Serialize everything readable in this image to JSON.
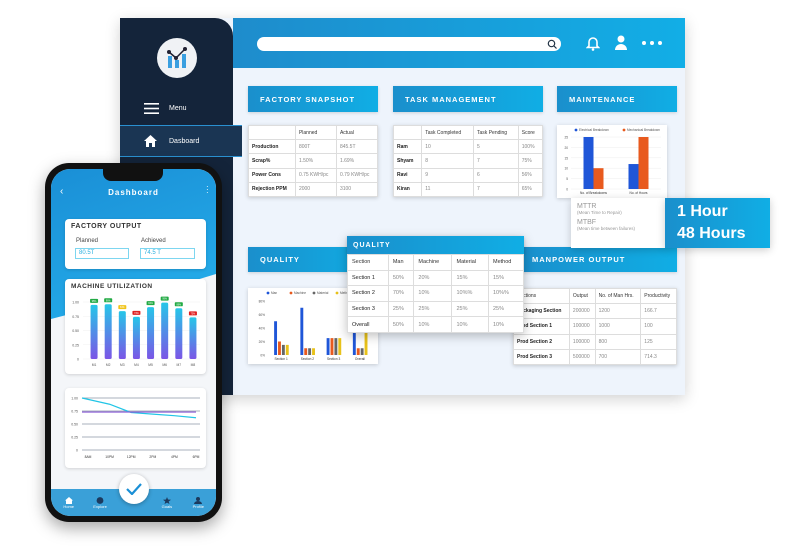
{
  "sidebar": {
    "menu_label": "Menu",
    "dashboard_label": "Dasboard"
  },
  "factory_snapshot": {
    "title": "FACTORY SNAPSHOT",
    "headers": [
      "",
      "Planned",
      "Actual"
    ],
    "rows": [
      [
        "Production",
        "800T",
        "845.5T"
      ],
      [
        "Scrap%",
        "1.50%",
        "1.69%"
      ],
      [
        "Power Cons",
        "0.75 KWH/pc",
        "0.79 KWH/pc"
      ],
      [
        "Rejection PPM",
        "2000",
        "3100"
      ]
    ]
  },
  "task_management": {
    "title": "TASK MANAGEMENT",
    "headers": [
      "",
      "Task Completed",
      "Task Pending",
      "Score"
    ],
    "rows": [
      [
        "Ram",
        "10",
        "5",
        "100%"
      ],
      [
        "Shyam",
        "8",
        "7",
        "75%"
      ],
      [
        "Ravi",
        "9",
        "6",
        "56%"
      ],
      [
        "Kiran",
        "11",
        "7",
        "65%"
      ]
    ]
  },
  "maintenance": {
    "title": "MAINTENANCE",
    "mttr_label": "MTTR",
    "mttr_desc": "(Mean Time to Repair)",
    "mttr_value": "1 Hour",
    "mtbf_label": "MTBF",
    "mtbf_desc": "(Mean time between failures)",
    "mtbf_value": "48 Hours"
  },
  "quality": {
    "title": "QUALITY",
    "popup_title": "QUALITY",
    "headers": [
      "Section",
      "Man",
      "Machine",
      "Material",
      "Method"
    ],
    "rows": [
      [
        "Section 1",
        "50%",
        "20%",
        "15%",
        "15%"
      ],
      [
        "Section 2",
        "70%",
        "10%",
        "10%%",
        "10%%"
      ],
      [
        "Section 3",
        "25%",
        "25%",
        "25%",
        "25%"
      ],
      [
        "Overall",
        "50%",
        "10%",
        "10%",
        "10%"
      ]
    ]
  },
  "manpower": {
    "title": "MANPOWER OUTPUT",
    "headers": [
      "Sections",
      "Output",
      "No. of Man Hrs.",
      "Productivity"
    ],
    "rows": [
      [
        "Packaging Section",
        "200000",
        "1200",
        "166.7"
      ],
      [
        "Prod Section 1",
        "100000",
        "1000",
        "100"
      ],
      [
        "Prod Section 2",
        "100000",
        "800",
        "125"
      ],
      [
        "Prod Section 3",
        "500000",
        "700",
        "714.3"
      ]
    ]
  },
  "phone": {
    "title": "Dashboard",
    "factory_output_title": "FACTORY OUTPUT",
    "planned_label": "Planned",
    "planned_value": "80.5T",
    "achieved_label": "Achieved",
    "achieved_value": "74.5 T",
    "machine_util_title": "MACHINE UTILIZATION",
    "nav": [
      "Home",
      "Explore",
      "Goals",
      "Profile"
    ]
  },
  "colors": {
    "accent": "#12a4e0",
    "navy": "#14243a",
    "electrical": "#1f56d8",
    "mechanical": "#e85a1e",
    "man": "#1f56d8",
    "machine": "#e85a1e",
    "material": "#666666",
    "method": "#e8c21a"
  },
  "chart_data": [
    {
      "type": "bar",
      "categories": [
        "No. of Breakdowns",
        "No. of Hours"
      ],
      "series": [
        {
          "name": "Electrical Breakdown",
          "values": [
            25,
            12
          ]
        },
        {
          "name": "Mechanical Breakdown",
          "values": [
            10,
            25
          ]
        }
      ],
      "ylim": [
        0,
        25
      ],
      "yticks": [
        "0",
        "5",
        "10",
        "15",
        "20",
        "25"
      ],
      "legend": "top",
      "grid": true
    },
    {
      "type": "bar",
      "categories": [
        "Section 1",
        "Section 2",
        "Section 3",
        "Overall"
      ],
      "series": [
        {
          "name": "Man",
          "values": [
            50,
            70,
            25,
            50
          ]
        },
        {
          "name": "Machine",
          "values": [
            20,
            10,
            25,
            10
          ]
        },
        {
          "name": "Material",
          "values": [
            15,
            10,
            25,
            10
          ]
        },
        {
          "name": "Method",
          "values": [
            15,
            10,
            25,
            40
          ]
        }
      ],
      "ylim": [
        0,
        80
      ],
      "yticks": [
        "0%",
        "20%",
        "40%",
        "60%",
        "80%"
      ],
      "legend": "top",
      "grid": false
    },
    {
      "type": "bar",
      "categories": [
        "M1",
        "M2",
        "M3",
        "M4",
        "M5",
        "M6",
        "M7",
        "M8"
      ],
      "values": [
        0.95,
        0.96,
        0.84,
        0.74,
        0.91,
        0.99,
        0.89,
        0.73
      ],
      "labels": [
        "95%",
        "96%",
        "84%",
        "74%",
        "91%",
        "99%",
        "89%",
        "73%"
      ],
      "ylim": [
        0,
        1
      ],
      "yticks": [
        "0",
        "0.25",
        "0.50",
        "0.75",
        "1.00"
      ],
      "grid": true
    },
    {
      "type": "line",
      "categories": [
        "8AM",
        "10PM",
        "12PM",
        "2PM",
        "4PM",
        "6PM"
      ],
      "series": [
        {
          "values": [
            1.0,
            0.88,
            0.72,
            0.69,
            0.66,
            0.62
          ]
        },
        {
          "values": [
            0.73,
            0.73,
            0.73,
            0.73,
            0.73,
            0.73
          ]
        }
      ],
      "ylim": [
        0,
        1
      ],
      "yticks": [
        "0",
        "0.25",
        "0.50",
        "0.75",
        "1.00"
      ],
      "grid": true
    }
  ]
}
